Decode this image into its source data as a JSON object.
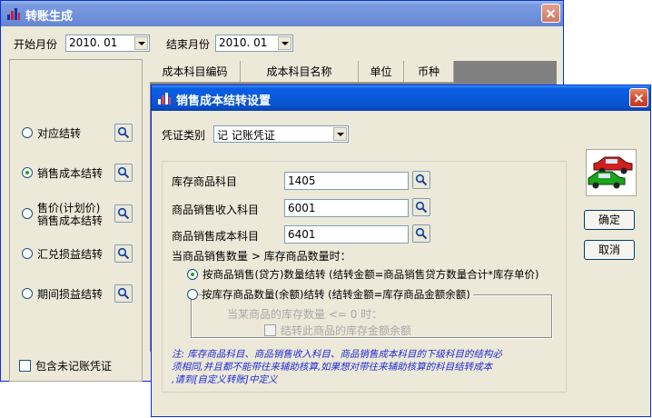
{
  "main_window": {
    "title": "转账生成",
    "start_month_label": "开始月份",
    "start_month_value": "2010. 01",
    "end_month_label": "结束月份",
    "end_month_value": "2010. 01",
    "options": [
      {
        "label": "对应结转",
        "selected": false
      },
      {
        "label": "销售成本结转",
        "selected": true
      },
      {
        "label_line1": "售价(计划价)",
        "label_line2": "销售成本结转",
        "selected": false
      },
      {
        "label": "汇兑损益结转",
        "selected": false
      },
      {
        "label": "期间损益结转",
        "selected": false
      }
    ],
    "include_unposted_label": "包含未记账凭证",
    "table_headers": [
      "成本科目编码",
      "成本科目名称",
      "单位",
      "币种"
    ]
  },
  "dialog": {
    "title": "销售成本结转设置",
    "voucher_type_label": "凭证类别",
    "voucher_type_value": "记 记账凭证",
    "fields": [
      {
        "label": "库存商品科目",
        "value": "1405"
      },
      {
        "label": "商品销售收入科目",
        "value": "6001"
      },
      {
        "label": "商品销售成本科目",
        "value": "6401"
      }
    ],
    "condition_text": "当商品销售数量 > 库存商品数量时：",
    "radio_option_1": "按商品销售(贷方)数量结转 (结转金额=商品销售贷方数量合计*库存单价)",
    "radio_option_2": "按库存商品数量(余额)结转 (结转金额=库存商品金额余额)",
    "sub_condition_text": "当某商品的库存数量 <= 0 时：",
    "sub_checkbox_label": "结转此商品的库存金额余额",
    "note_line1": "注: 库存商品科目、商品销售收入科目、商品销售成本科目的下级科目的结构必",
    "note_line2": "须相同,并且都不能带往来辅助核算,如果想对带往来辅助核算的科目结转成本",
    "note_line3": ",请到[自定义转账]中定义",
    "ok_label": "确定",
    "cancel_label": "取消"
  },
  "icons": {
    "title_icon": "bar-chart-icon",
    "search": "search-icon",
    "cars": "cars-icon",
    "close": "close-icon"
  },
  "colors": {
    "titlebar_active": "#0b58d8",
    "titlebar_inactive": "#7a9be0",
    "window_bg": "#ece9d8",
    "note_text": "#1e2cd8"
  }
}
